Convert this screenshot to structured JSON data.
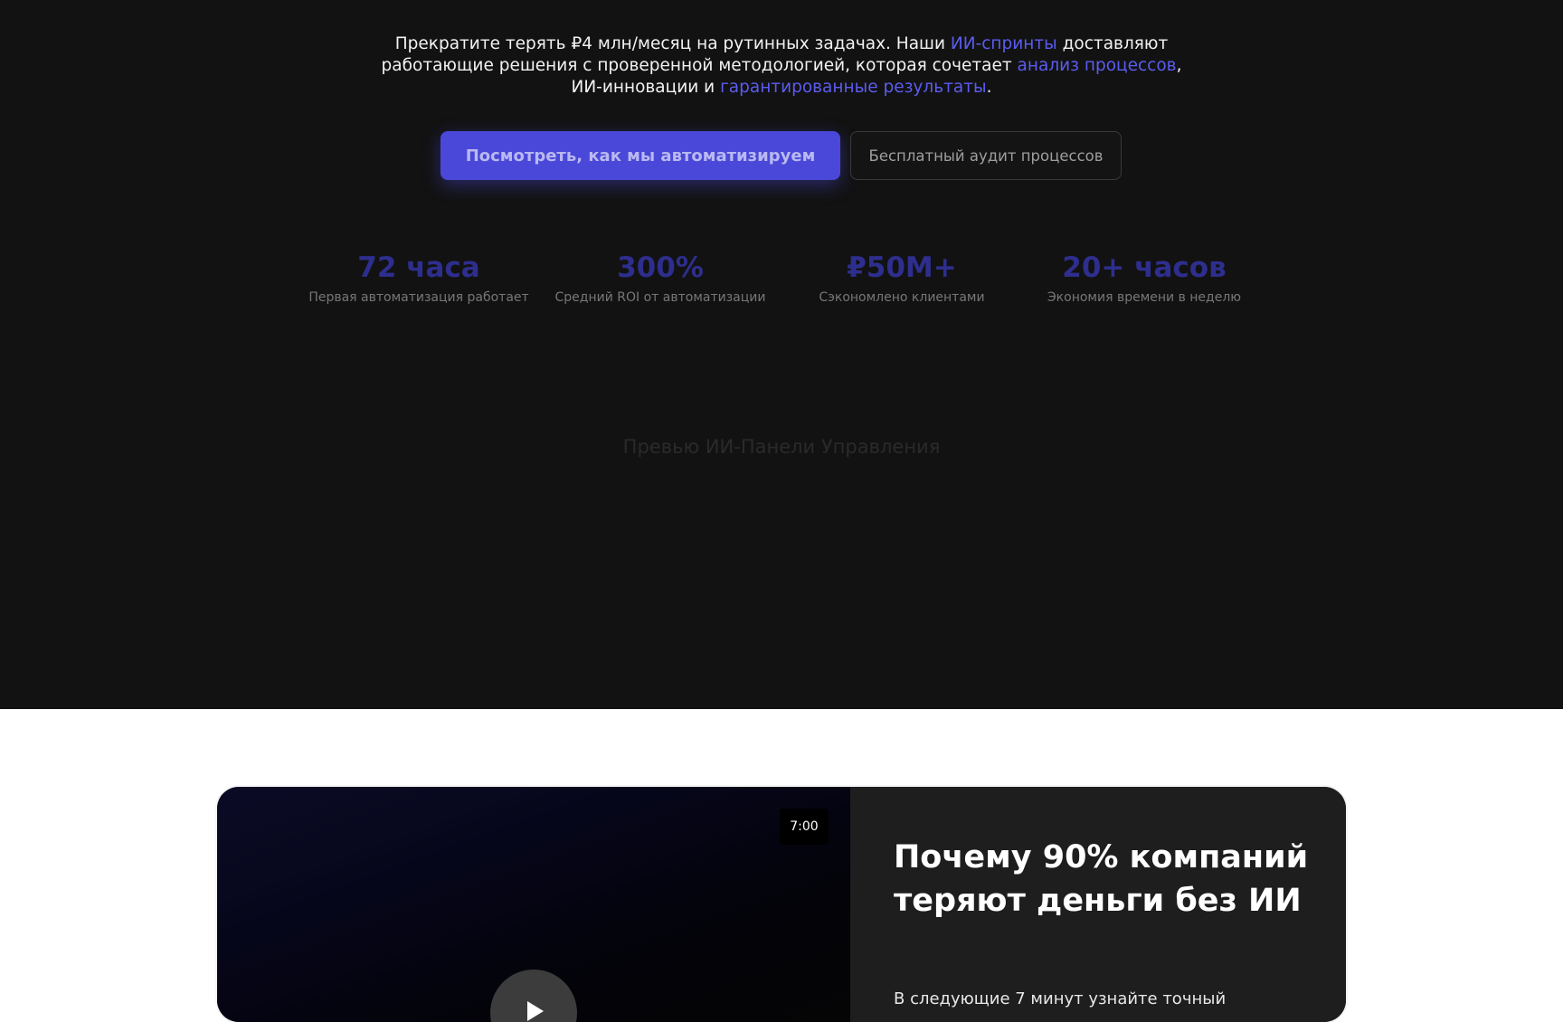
{
  "hero": {
    "text": {
      "p1": "Прекратите терять ₽4 млн/месяц на рутинных задачах. Наши ",
      "h1": "ИИ-спринты",
      "p2": " доставляют работающие решения с проверенной методологией, которая сочетает ",
      "h2": "анализ процессов",
      "p3": ", ИИ-инновации и ",
      "h3": "гарантированные результаты",
      "p4": "."
    },
    "primary_cta": "Посмотреть, как мы автоматизируем",
    "secondary_cta": "Бесплатный аудит процессов",
    "stats": [
      {
        "value": "72 часа",
        "label": "Первая автоматизация работает"
      },
      {
        "value": "300%",
        "label": "Средний ROI от автоматизации"
      },
      {
        "value": "₽50M+",
        "label": "Сэкономлено клиентами"
      },
      {
        "value": "20+ часов",
        "label": "Экономия времени в неделю"
      }
    ],
    "preview_label": "Превью ИИ-Панели Управления"
  },
  "video_card": {
    "duration": "7:00",
    "title": "Почему 90% компаний теряют деньги без ИИ",
    "description": "В следующие 7 минут узнайте точный"
  },
  "colors": {
    "accent": "#4a48d8",
    "link": "#5b5cf0",
    "hero_bg": "#121212",
    "card_bg": "#1e1e1e"
  },
  "icons": {
    "play": "play-icon"
  }
}
